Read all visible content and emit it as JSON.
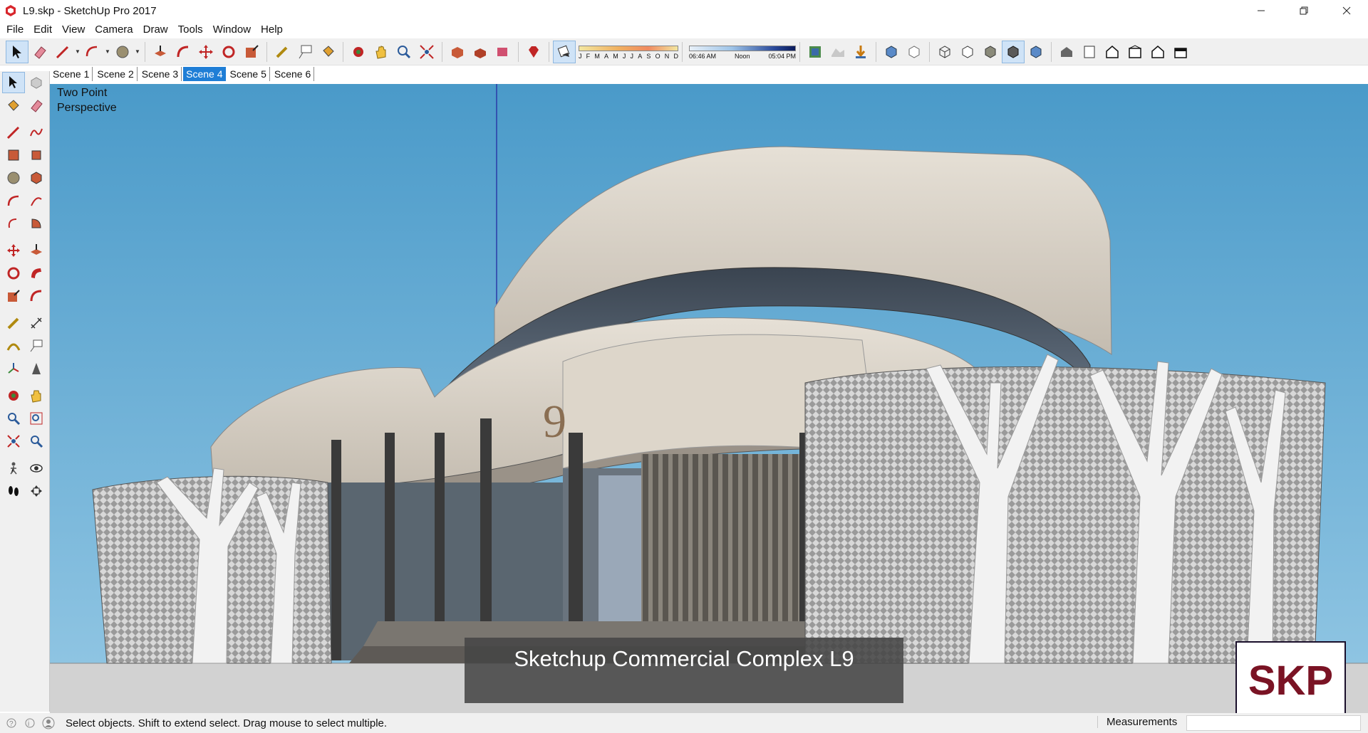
{
  "window": {
    "title": "L9.skp - SketchUp Pro 2017",
    "app_icon": "sketchup-logo-icon",
    "controls": [
      "minimize-icon",
      "restore-icon",
      "close-icon"
    ]
  },
  "menu": [
    "File",
    "Edit",
    "View",
    "Camera",
    "Draw",
    "Tools",
    "Window",
    "Help"
  ],
  "shadow_settings": {
    "months": [
      "J",
      "F",
      "M",
      "A",
      "M",
      "J",
      "J",
      "A",
      "S",
      "O",
      "N",
      "D"
    ],
    "time_start": "06:46 AM",
    "time_mid": "Noon",
    "time_end": "05:04 PM"
  },
  "scenes": {
    "tabs": [
      "Scene 1",
      "Scene 2",
      "Scene 3",
      "Scene 4",
      "Scene 5",
      "Scene 6"
    ],
    "active_index": 3
  },
  "viewport": {
    "camera_mode_line1": "Two Point",
    "camera_mode_line2": "Perspective",
    "caption": "Sketchup Commercial Complex L9",
    "logo_text": "SKP"
  },
  "status": {
    "message": "Select objects. Shift to extend select. Drag mouse to select multiple.",
    "measurements_label": "Measurements",
    "measurements_value": ""
  },
  "colors": {
    "accent": "#1f7ed6",
    "sky_top": "#4a9ac9",
    "sky_bottom": "#8ec4e2",
    "logo_red": "#7a1324"
  }
}
